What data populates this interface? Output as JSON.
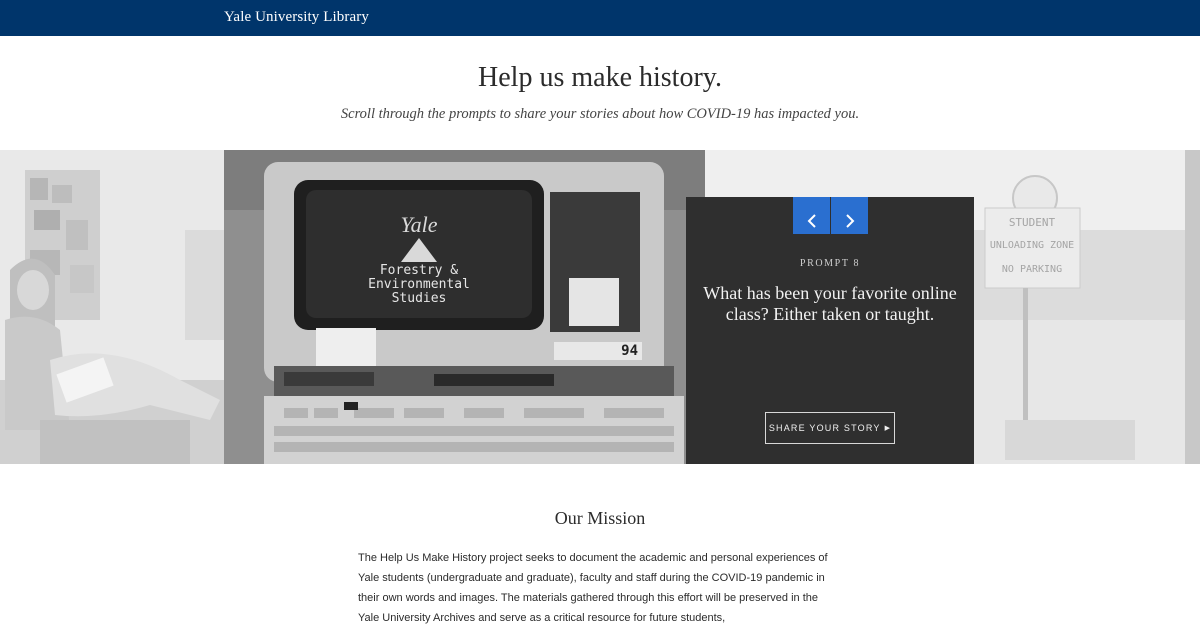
{
  "header": {
    "brand": "Yale University Library"
  },
  "hero": {
    "title": "Help us make history.",
    "subtitle": "Scroll through the prompts to share your stories about how COVID-19 has impacted you."
  },
  "carousel": {
    "prompt_label": "PROMPT 8",
    "question": "What has been your favorite online class? Either taken or taught.",
    "share_label": "SHARE YOUR STORY",
    "photo_text": {
      "screen_logo": "Yale",
      "screen_line1": "Forestry &",
      "screen_line2": "Environmental",
      "screen_line3": "Studies",
      "terminal_number": "94",
      "sign_line1": "STUDENT",
      "sign_line2": "UNLOADING ZONE",
      "sign_line3": "NO PARKING"
    }
  },
  "mission": {
    "title": "Our Mission",
    "body": "The Help Us Make History project seeks to document the academic and personal experiences of Yale students (undergraduate and graduate), faculty and staff during the COVID-19 pandemic in their own words and images. The materials gathered through this effort will be preserved in the Yale University Archives and serve as a critical resource for future students,"
  },
  "colors": {
    "header_bg": "#00356b",
    "nav_button": "#2a6fd0",
    "card_bg": "#2f2f2f"
  }
}
